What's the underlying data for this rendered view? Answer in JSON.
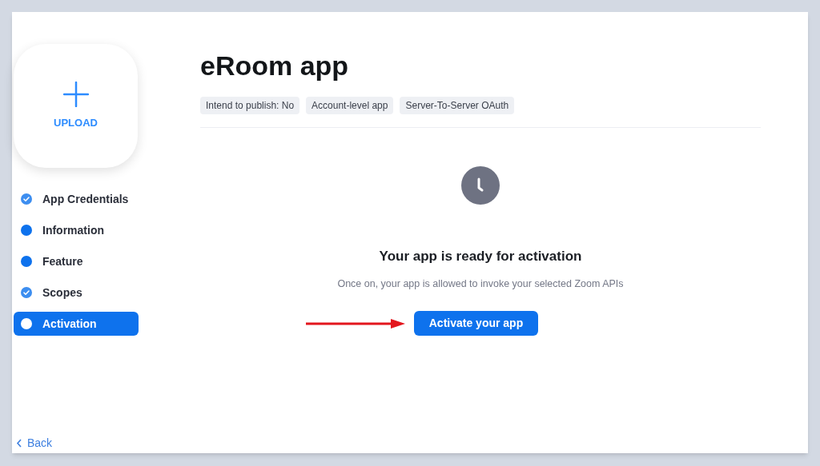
{
  "upload": {
    "label": "UPLOAD"
  },
  "steps": [
    {
      "label": "App Credentials",
      "kind": "done",
      "selected": false
    },
    {
      "label": "Information",
      "kind": "dot",
      "selected": false
    },
    {
      "label": "Feature",
      "kind": "dot",
      "selected": false
    },
    {
      "label": "Scopes",
      "kind": "done",
      "selected": false
    },
    {
      "label": "Activation",
      "kind": "dot",
      "selected": true
    }
  ],
  "back": "Back",
  "title": "eRoom app",
  "tags": [
    "Intend to publish: No",
    "Account-level app",
    "Server-To-Server OAuth"
  ],
  "status": {
    "heading": "Your app is ready for activation",
    "description": "Once on, your app is allowed to invoke your selected Zoom APIs",
    "button": "Activate your app"
  }
}
